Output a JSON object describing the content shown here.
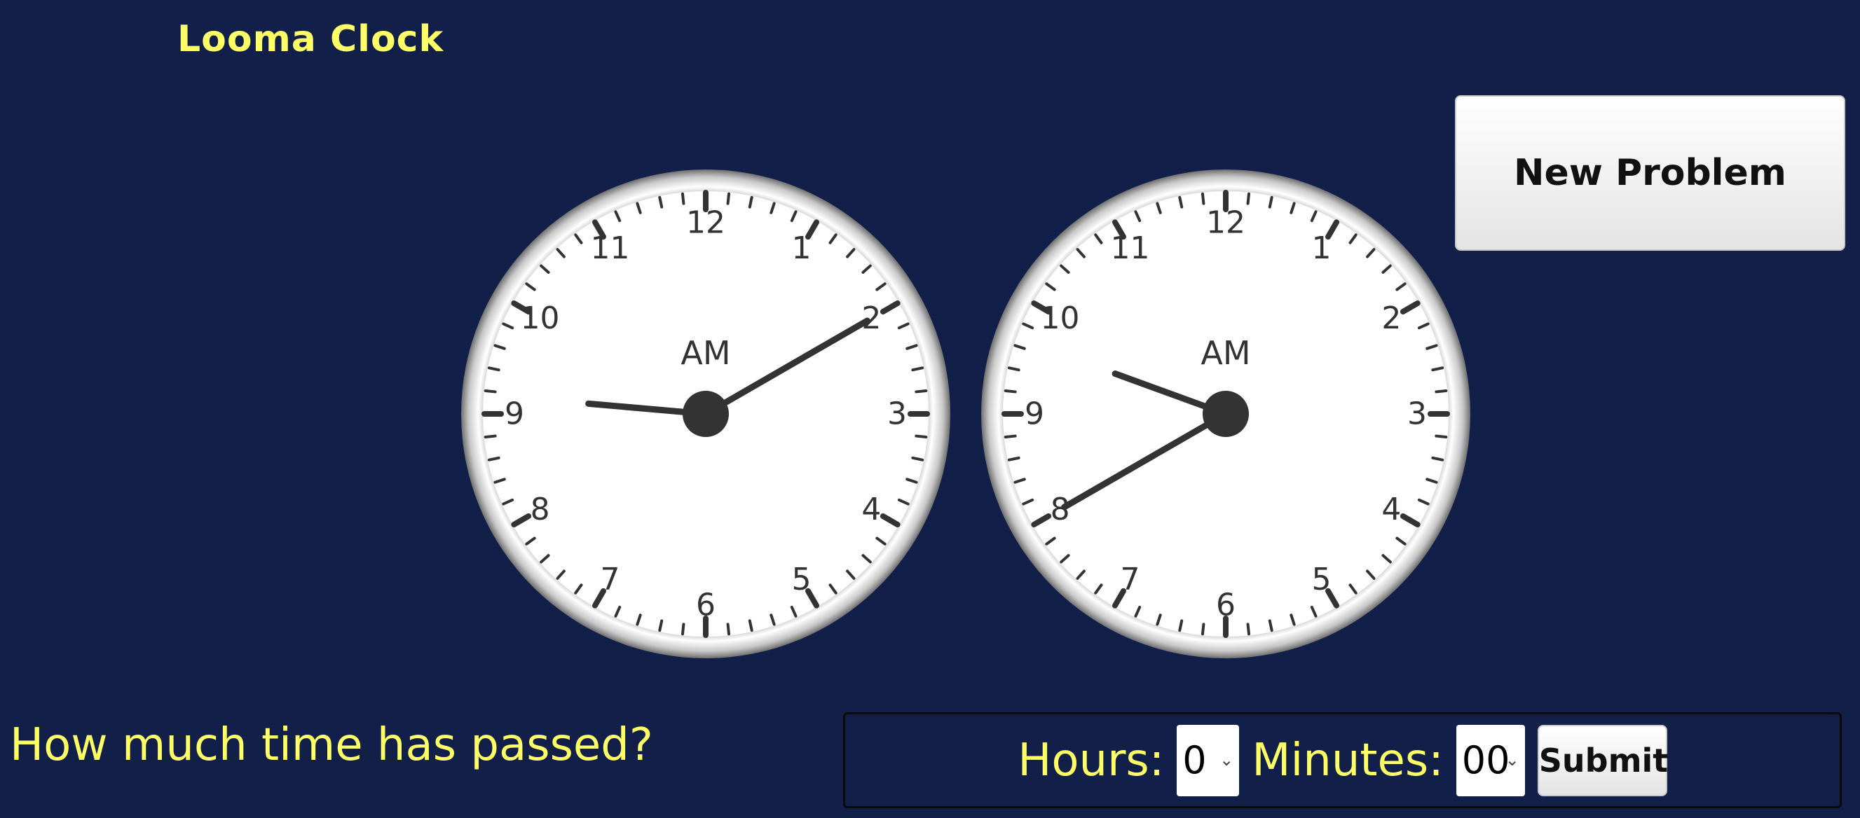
{
  "app": {
    "title": "Looma Clock"
  },
  "toolbar": {
    "new_problem_label": "New Problem"
  },
  "clocks": [
    {
      "period": "AM",
      "time": "9:10",
      "numbers": [
        "12",
        "1",
        "2",
        "3",
        "4",
        "5",
        "6",
        "7",
        "8",
        "9",
        "10",
        "11"
      ]
    },
    {
      "period": "AM",
      "time": "9:40",
      "numbers": [
        "12",
        "1",
        "2",
        "3",
        "4",
        "5",
        "6",
        "7",
        "8",
        "9",
        "10",
        "11"
      ]
    }
  ],
  "question": {
    "text": "How much time has passed?"
  },
  "answer": {
    "hours_label": "Hours:",
    "hours_value": "0",
    "minutes_label": "Minutes:",
    "minutes_value": "00",
    "submit_label": "Submit"
  },
  "colors": {
    "background": "#111f49",
    "accent_text": "#ffff66",
    "clock_face": "#ffffff",
    "hand": "#333333"
  }
}
